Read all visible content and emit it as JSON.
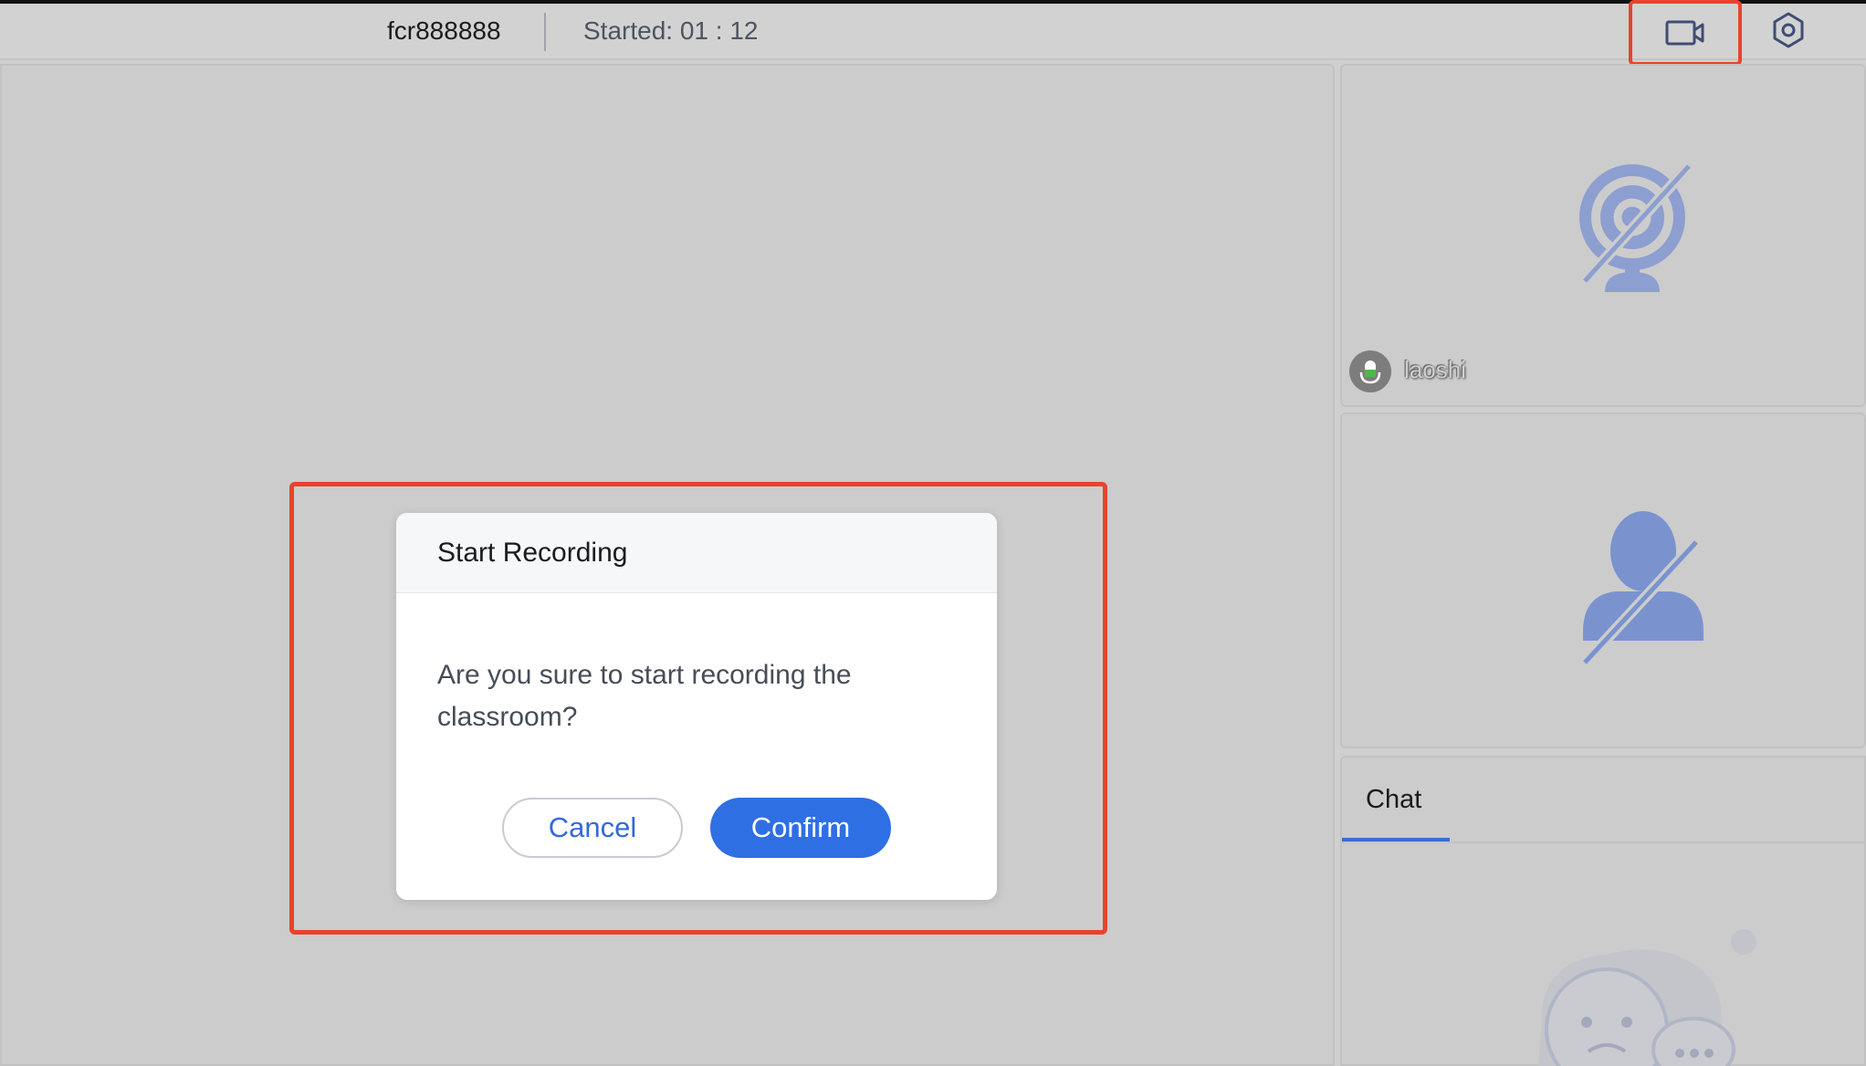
{
  "topbar": {
    "room_name": "fcr888888",
    "started_label": "Started: 01 : 12",
    "record_icon": "video-camera-icon",
    "settings_icon": "settings-hexagon-icon"
  },
  "video": {
    "teacher": {
      "name": "laoshi",
      "camera_icon": "camera-off-icon",
      "mic_icon": "microphone-icon"
    },
    "student": {
      "avatar_icon": "user-off-icon"
    }
  },
  "chat": {
    "tab_label": "Chat",
    "empty_icon": "empty-chat-icon"
  },
  "dialog": {
    "title": "Start Recording",
    "message": "Are you sure to start recording the classroom?",
    "cancel_label": "Cancel",
    "confirm_label": "Confirm"
  },
  "colors": {
    "accent": "#2f6fe4",
    "highlight": "#e8432d",
    "background": "#cfcfcf"
  }
}
